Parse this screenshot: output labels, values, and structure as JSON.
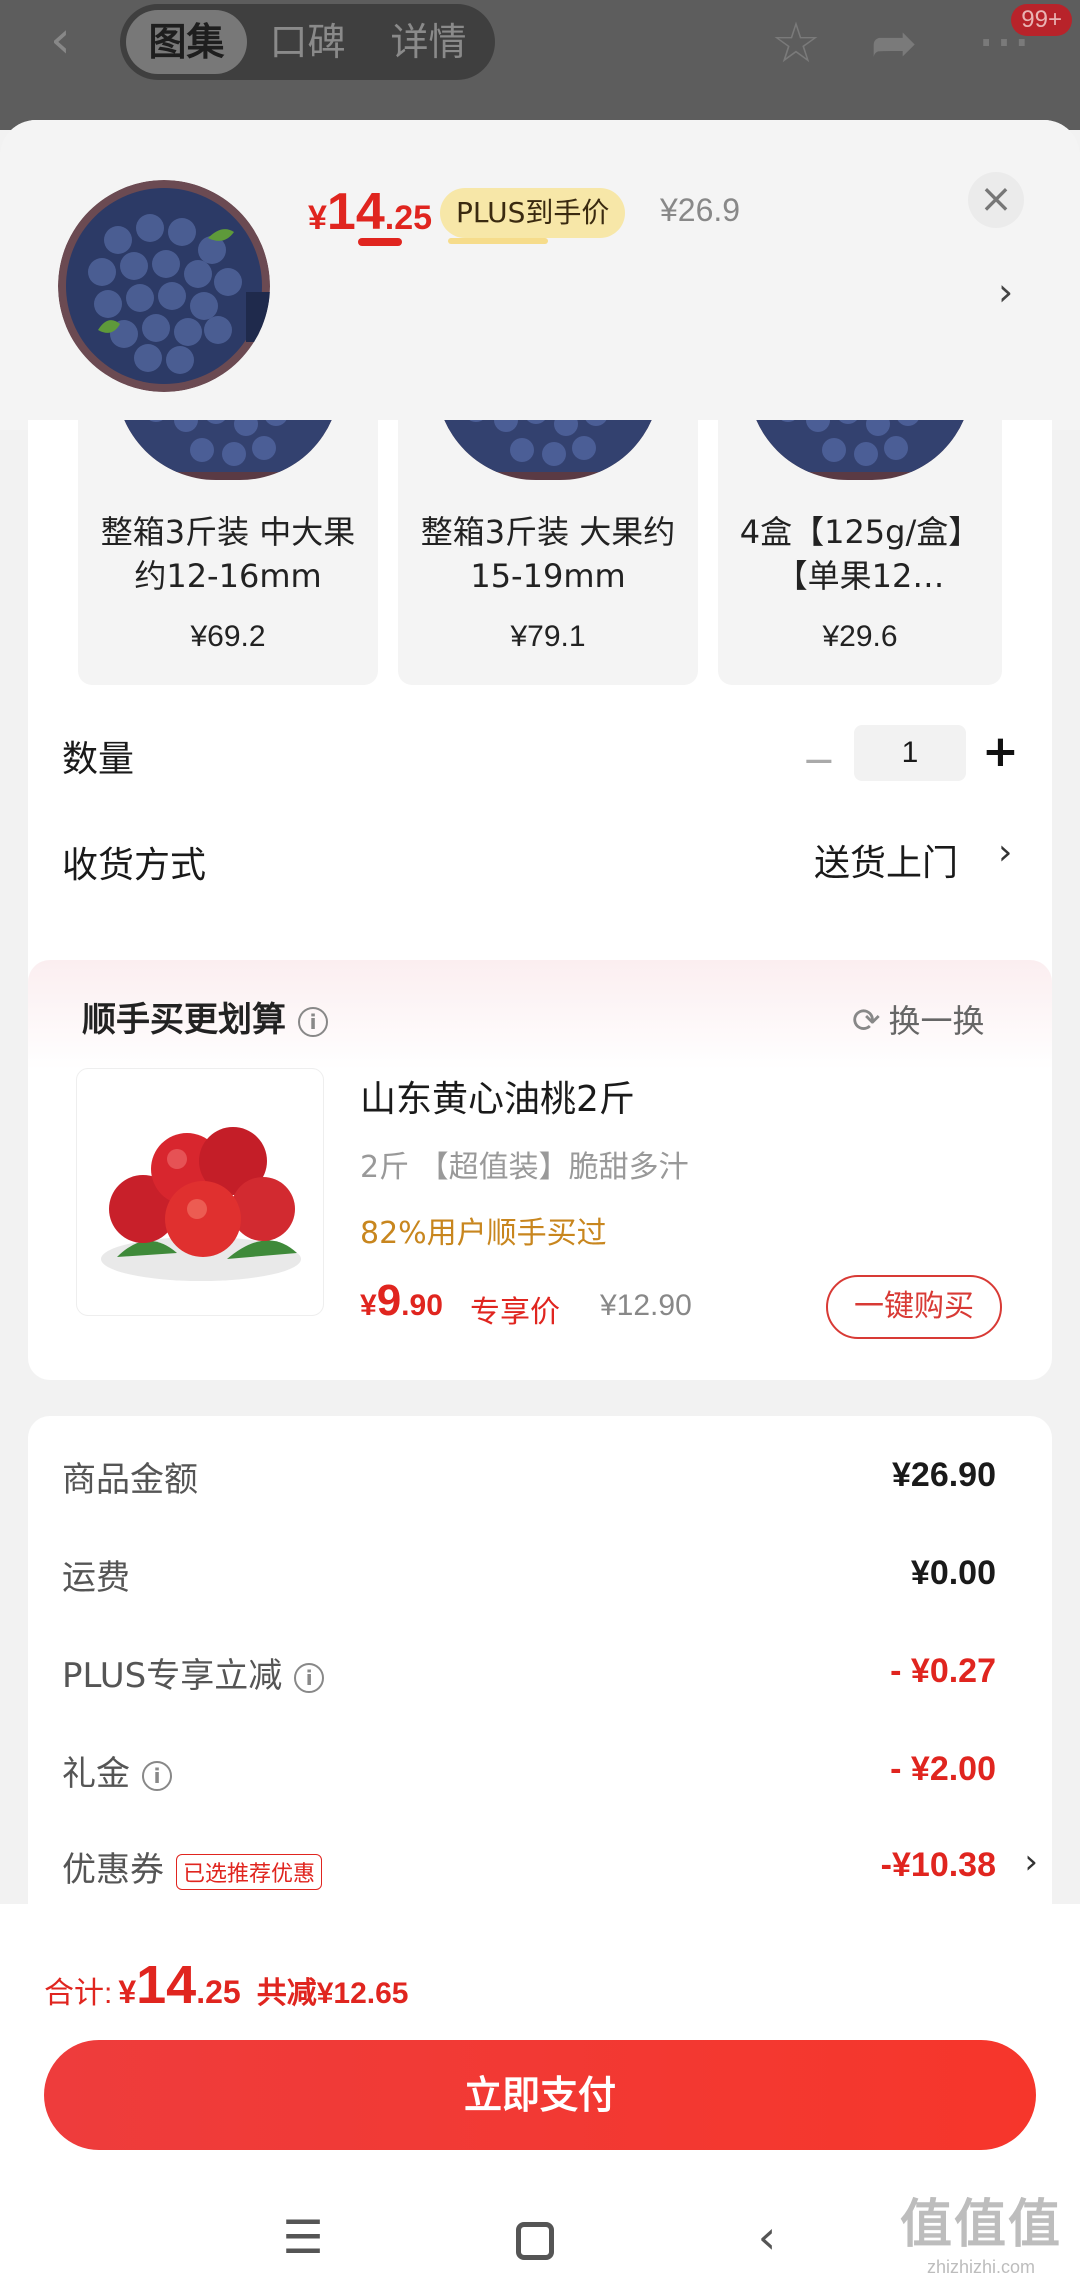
{
  "topbar": {
    "tabs": [
      "图集",
      "口碑",
      "详情"
    ],
    "active_tab": 0,
    "badge": "99+",
    "icons": [
      "back-icon",
      "star-icon",
      "share-icon",
      "more-icon"
    ]
  },
  "product": {
    "price_symbol": "¥",
    "price_int": "14",
    "price_dec": ".25",
    "plus_tag": "PLUS到手价",
    "original_price": "¥26.9"
  },
  "specs": [
    {
      "name": "整箱3斤装 中大果 约12-16mm",
      "price": "¥69.2"
    },
    {
      "name": "整箱3斤装 大果约15-19mm",
      "price": "¥79.1"
    },
    {
      "name": "4盒【125g/盒】【单果12…",
      "price": "¥29.6"
    }
  ],
  "quantity": {
    "label": "数量",
    "value": "1",
    "minus": "−",
    "plus": "+"
  },
  "delivery": {
    "label": "收货方式",
    "value": "送货上门"
  },
  "recommend": {
    "title": "顺手买更划算",
    "swap_label": "换一换",
    "name": "山东黄心油桃2斤",
    "spec": "2斤  【超值装】脆甜多汁",
    "bought": "82%用户顺手买过",
    "price_symbol": "¥",
    "price_int": "9",
    "price_dec": ".90",
    "price_tag": "专享价",
    "original_price": "¥12.90",
    "buy_label": "一键购买"
  },
  "summary": [
    {
      "label": "商品金额",
      "value": "¥26.90",
      "red": false,
      "info": false
    },
    {
      "label": "运费",
      "value": "¥0.00",
      "red": false,
      "info": false
    },
    {
      "label": "PLUS专享立减",
      "value": "- ¥0.27",
      "red": true,
      "info": true
    },
    {
      "label": "礼金",
      "value": "- ¥2.00",
      "red": true,
      "info": true
    }
  ],
  "coupon": {
    "label": "优惠券",
    "tag": "已选推荐优惠",
    "value": "-¥10.38"
  },
  "bottom": {
    "total_label": "合计:",
    "total_symbol": "¥",
    "total_int": "14",
    "total_dec": ".25",
    "saved": "共减¥12.65",
    "pay_label": "立即支付"
  },
  "watermark": {
    "logo": "值值值",
    "url": "zhizhizhi.com"
  },
  "colors": {
    "accent": "#e0251f",
    "gold": "#c8861e"
  }
}
